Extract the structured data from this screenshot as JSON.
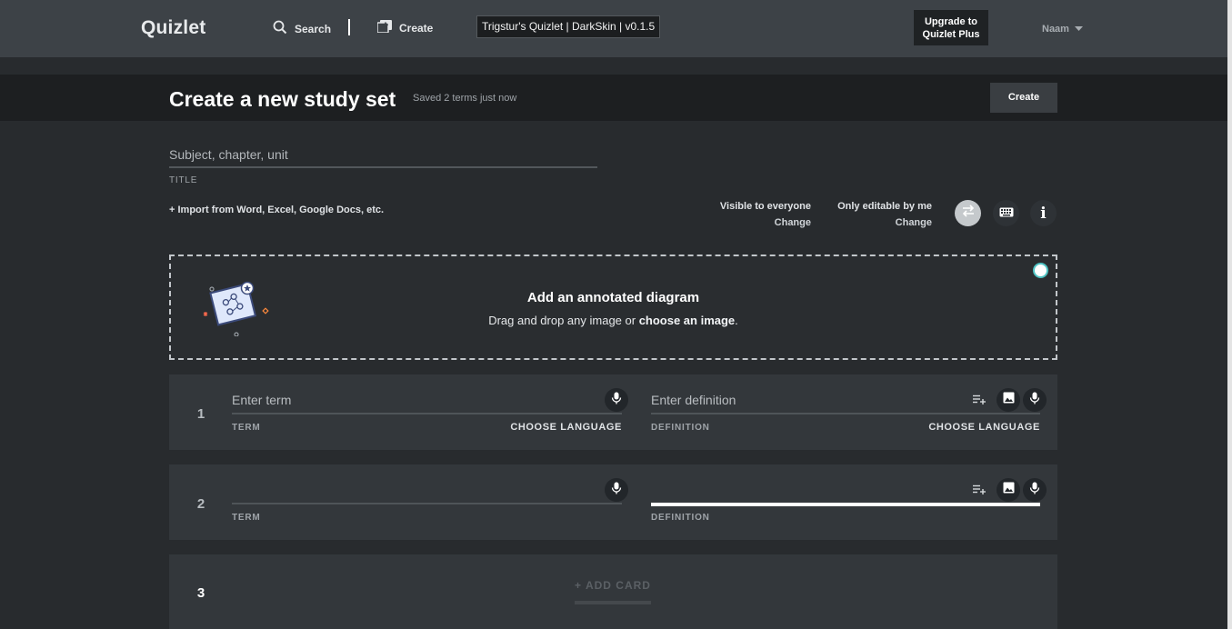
{
  "nav": {
    "logo": "Quizlet",
    "search_label": "Search",
    "create_label": "Create",
    "skin_badge": "Trigstur's Quizlet | DarkSkin | v0.1.5",
    "upgrade_line1": "Upgrade to",
    "upgrade_line2": "Quizlet Plus",
    "user_name": "Naam"
  },
  "header": {
    "title": "Create a new study set",
    "saved_status": "Saved 2 terms just now",
    "create_button": "Create"
  },
  "set_info": {
    "title_placeholder": "Subject, chapter, unit",
    "title_label": "TITLE",
    "import_link": "+ Import from Word, Excel, Google Docs, etc.",
    "visibility": "Visible to everyone",
    "visibility_change": "Change",
    "editability": "Only editable by me",
    "editability_change": "Change"
  },
  "diagram": {
    "title": "Add an annotated diagram",
    "subtitle_prefix": "Drag and drop any image or ",
    "subtitle_link": "choose an image",
    "subtitle_suffix": "."
  },
  "cards": [
    {
      "number": "1",
      "term_placeholder": "Enter term",
      "term_label": "TERM",
      "term_language": "CHOOSE LANGUAGE",
      "definition_placeholder": "Enter definition",
      "definition_label": "DEFINITION",
      "definition_language": "CHOOSE LANGUAGE"
    },
    {
      "number": "2",
      "term_placeholder": "",
      "term_label": "TERM",
      "definition_placeholder": "",
      "definition_label": "DEFINITION"
    },
    {
      "number": "3",
      "add_card_label": "+ ADD CARD"
    }
  ],
  "colors": {
    "nav_bg": "#3d4247",
    "page_bg": "#282b2e",
    "header_band": "#1d1f21",
    "card_bg": "#33373b",
    "accent_toggle": "#4fc3c3"
  },
  "icons": [
    "search-icon",
    "create-set-icon",
    "chevron-down-icon",
    "swap-icon",
    "keyboard-icon",
    "info-icon",
    "diagram-illustration",
    "microphone-icon",
    "image-icon",
    "add-list-icon"
  ]
}
